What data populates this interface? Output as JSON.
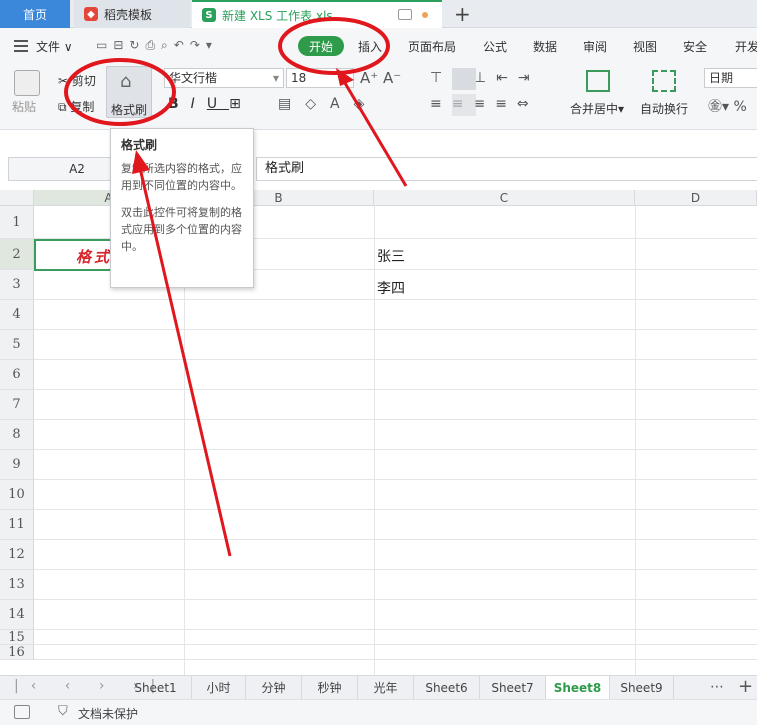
{
  "tabs": [
    {
      "label": "首页"
    },
    {
      "label": "稻壳模板"
    },
    {
      "label": "新建 XLS 工作表.xls"
    }
  ],
  "menu": {
    "file": "文件",
    "start": "开始",
    "insert": "插入",
    "page_layout": "页面布局",
    "formula": "公式",
    "data": "数据",
    "review": "审阅",
    "view": "视图",
    "security": "安全",
    "developer": "开发"
  },
  "ribbon": {
    "paste": "粘贴",
    "cut": "剪切",
    "copy": "复制",
    "format_painter": "格式刷",
    "font_name": "华文行楷",
    "font_size": "18",
    "merge_center": "合并居中",
    "wrap_text": "自动换行",
    "number_format": "日期"
  },
  "formula_bar": {
    "cell_ref": "A2",
    "content": "格式刷"
  },
  "grid": {
    "columns": [
      "A",
      "B",
      "C",
      "D"
    ],
    "rows": [
      "1",
      "2",
      "3",
      "4",
      "5",
      "6",
      "7",
      "8",
      "9",
      "10",
      "11",
      "12",
      "13",
      "14",
      "15",
      "16"
    ],
    "cell_a2": "格式刷",
    "cell_c2": "张三",
    "cell_c3": "李四"
  },
  "sheets": [
    {
      "name": "Sheet1",
      "active": false
    },
    {
      "name": "小时",
      "active": false
    },
    {
      "name": "分钟",
      "active": false
    },
    {
      "name": "秒钟",
      "active": false
    },
    {
      "name": "光年",
      "active": false
    },
    {
      "name": "Sheet6",
      "active": false
    },
    {
      "name": "Sheet7",
      "active": false
    },
    {
      "name": "Sheet8",
      "active": true
    },
    {
      "name": "Sheet9",
      "active": false
    }
  ],
  "status": {
    "protection": "文档未保护"
  },
  "tooltip": {
    "title": "格式刷",
    "line1": "复制所选内容的格式，应用到不同位置的内容中。",
    "line2": "双击此控件可将复制的格式应用到多个位置的内容中。"
  },
  "colors": {
    "accent_green": "#2e9b4a",
    "home_tab_blue": "#3b87d9",
    "annotation_red": "#e0171d",
    "cell_text_red": "#d6262b"
  }
}
